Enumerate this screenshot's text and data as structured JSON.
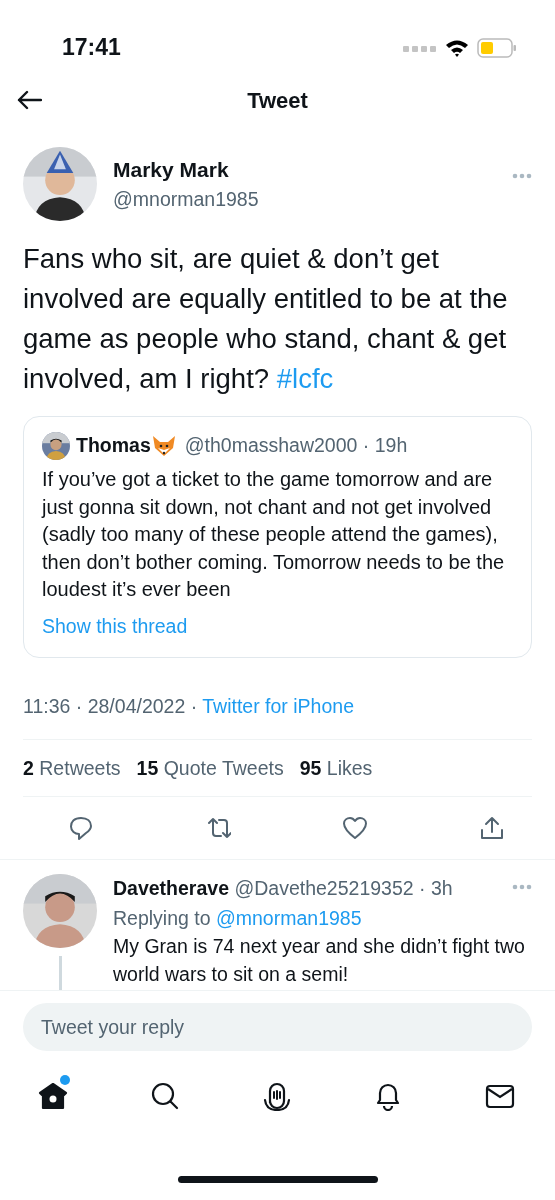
{
  "status_bar": {
    "time": "17:41"
  },
  "header": {
    "title": "Tweet"
  },
  "tweet": {
    "author": {
      "name": "Marky Mark",
      "handle": "@mnorman1985"
    },
    "text": "Fans who sit, are quiet & don’t get involved are equally entitled to be at the game as people who stand, chant & get involved, am I right? ",
    "hashtag": "#lcfc",
    "quote": {
      "name": "Thomas",
      "handle_time": "@th0masshaw2000 · 19h",
      "text": "If you’ve got a ticket to the game tomorrow and are just gonna sit down, not chant and not get involved (sadly too many of these people attend the games), then don’t bother coming. Tomorrow needs to be the loudest it’s ever been",
      "link": "Show this thread"
    },
    "timestamp": "11:36 · 28/04/2022 ·",
    "source": "Twitter for iPhone",
    "stats": [
      {
        "count": "2",
        "label": "Retweets"
      },
      {
        "count": "15",
        "label": "Quote Tweets"
      },
      {
        "count": "95",
        "label": "Likes"
      }
    ],
    "actions": [
      {
        "kind": "reply"
      },
      {
        "kind": "retweet"
      },
      {
        "kind": "like"
      },
      {
        "kind": "share"
      }
    ]
  },
  "reply": {
    "name": "Davetherave",
    "handle_time": "@Davethe25219352 · 3h",
    "replying_prefix": "Replying to",
    "replying_to": "@mnorman1985",
    "text": "My Gran is 74 next year and she didn’t fight two world wars to sit on a semi!"
  },
  "reply_field": {
    "placeholder": "Tweet your reply"
  },
  "tab_bar": [
    {
      "kind": "home",
      "selected": true,
      "badge": true
    },
    {
      "kind": "search",
      "selected": false,
      "badge": false
    },
    {
      "kind": "spaces",
      "selected": false,
      "badge": false
    },
    {
      "kind": "notifications",
      "selected": false,
      "badge": false
    },
    {
      "kind": "messages",
      "selected": false,
      "badge": false
    }
  ]
}
